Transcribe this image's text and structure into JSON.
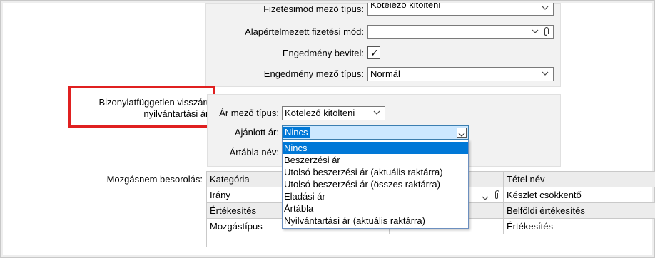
{
  "form": {
    "payment_field_type": {
      "label": "Fizetésimód mező típus:",
      "value": "Kötelező kitölteni"
    },
    "default_payment": {
      "label": "Alapértelmezett fizetési mód:",
      "value": ""
    },
    "discount_entry": {
      "label": "Engedmény bevitel:",
      "checked": true,
      "check_glyph": "✓"
    },
    "discount_field_type": {
      "label": "Engedmény mező típus:",
      "value": "Normál"
    },
    "doc_independent_price_label": "Bizonylatfüggetlen visszáru nyilvántartási ár:",
    "price_field_type": {
      "label": "Ár mező típus:",
      "value": "Kötelező kitölteni"
    },
    "suggested_price": {
      "label": "Ajánlott ár:",
      "value": "Nincs"
    },
    "price_table_name": {
      "label": "Ártábla név:"
    }
  },
  "dropdown": {
    "options": [
      "Nincs",
      "Beszerzési ár",
      "Utolsó beszerzési ár (aktuális raktárra)",
      "Utolsó beszerzési ár (összes raktárra)",
      "Eladási ár",
      "Ártábla",
      "Nyilvántartási ár (aktuális raktárra)"
    ],
    "selected_index": 0
  },
  "movement": {
    "label": "Mozgásnem besorolás:",
    "rows": [
      {
        "c1": "Kategória",
        "c2": "",
        "c3": "Tétel név"
      },
      {
        "c1": "Irány",
        "c2": "",
        "c3": "Készlet csökkentő"
      },
      {
        "c1": "Értékesítés",
        "c2": "",
        "c3": "Belföldi értékesítés"
      },
      {
        "c1": "Mozgástípus",
        "c2": "ÉRT",
        "c3": "Értékesítés"
      }
    ]
  },
  "colors": {
    "highlight": "#e02020",
    "selection": "#0078d7",
    "active_field": "#cce8ff"
  }
}
